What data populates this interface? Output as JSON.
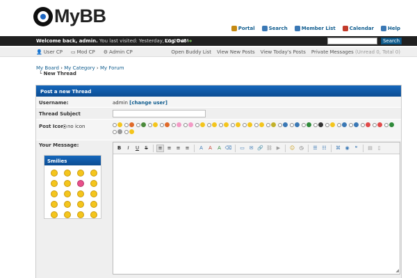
{
  "logo": {
    "text": "MyBB"
  },
  "toplinks": [
    {
      "label": "Portal",
      "icon": "portal-icon",
      "color": "#c58a12"
    },
    {
      "label": "Search",
      "icon": "search-icon",
      "color": "#3a78b5"
    },
    {
      "label": "Member List",
      "icon": "members-icon",
      "color": "#3a78b5"
    },
    {
      "label": "Calendar",
      "icon": "calendar-icon",
      "color": "#c23b2b"
    },
    {
      "label": "Help",
      "icon": "help-icon",
      "color": "#3a78b5"
    }
  ],
  "welcome": {
    "greeting": "Welcome back, admin.",
    "last_visit": "You last visited: Yesterday, 01:27 AM",
    "logout": "Log Out",
    "search_button": "Search",
    "search_placeholder": ""
  },
  "panel": {
    "left": [
      "User CP",
      "Mod CP",
      "Admin CP"
    ],
    "right": [
      "Open Buddy List",
      "View New Posts",
      "View Today's Posts"
    ],
    "pm_label": "Private Messages",
    "pm_counts": "(Unread 0, Total 0)"
  },
  "breadcrumb": {
    "items": [
      "My Board",
      "My Category",
      "My Forum"
    ],
    "sep": "›",
    "current": "New Thread",
    "current_prefix": "└"
  },
  "form": {
    "title": "Post a new Thread",
    "username_label": "Username:",
    "username_value": "admin",
    "change_user": "[change user]",
    "subject_label": "Thread Subject",
    "subject_value": "",
    "icon_label": "Post Icon:",
    "no_icon": "no icon",
    "message_label": "Your Message:",
    "smilies_title": "Smilies"
  },
  "post_icons": [
    "#f4c51c",
    "#e06a2a",
    "#4a8a3a",
    "#f4c51c",
    "#e06a2a",
    "#f39bc6",
    "#f39bc6",
    "#f4c51c",
    "#f4c51c",
    "#f4c51c",
    "#f4c51c",
    "#f4c51c",
    "#f4c51c",
    "#c2b12a",
    "#3a78b5",
    "#3a78b5",
    "#2f8a3a",
    "#333333",
    "#f4c51c",
    "#3a78b5",
    "#3a78b5",
    "#e04a4a",
    "#e04a4a",
    "#2f8a3a",
    "#999999",
    "#f4c51c"
  ],
  "smilies_count": 20,
  "toolbar_buttons": [
    {
      "name": "bold-button",
      "label": "B",
      "style": "bold"
    },
    {
      "name": "italic-button",
      "label": "I",
      "style": "italic"
    },
    {
      "name": "underline-button",
      "label": "U",
      "style": "underline"
    },
    {
      "name": "strike-button",
      "label": "S",
      "style": "strike"
    },
    "sep",
    {
      "name": "align-left-button",
      "label": "≡",
      "sel": true
    },
    {
      "name": "align-center-button",
      "label": "≡"
    },
    {
      "name": "align-right-button",
      "label": "≡"
    },
    {
      "name": "justify-button",
      "label": "≡"
    },
    "sep",
    {
      "name": "font-button",
      "label": "A",
      "color": "#3a78b5"
    },
    {
      "name": "size-button",
      "label": "A",
      "color": "#c23b2b"
    },
    {
      "name": "color-button",
      "label": "A",
      "color": "#2f8a3a"
    },
    {
      "name": "remove-format-button",
      "label": "⌫",
      "color": "#3a78b5"
    },
    "sep",
    {
      "name": "image-button",
      "label": "▭",
      "color": "#3a78b5"
    },
    {
      "name": "email-button",
      "label": "✉",
      "color": "#3a78b5"
    },
    {
      "name": "link-button",
      "label": "🔗",
      "color": "#3a78b5"
    },
    {
      "name": "unlink-button",
      "label": "⛓",
      "color": "#999"
    },
    {
      "name": "video-button",
      "label": "▶",
      "color": "#999"
    },
    "sep",
    {
      "name": "smiley-button",
      "label": "☺",
      "color": "#c99a10"
    },
    {
      "name": "date-button",
      "label": "◷",
      "color": "#555"
    },
    "sep",
    {
      "name": "bullet-list-button",
      "label": "☰",
      "color": "#3a78b5"
    },
    {
      "name": "ordered-list-button",
      "label": "☷",
      "color": "#3a78b5"
    },
    "sep",
    {
      "name": "code-button",
      "label": "⌘",
      "color": "#3a78b5"
    },
    {
      "name": "php-button",
      "label": "◉",
      "color": "#3a78b5"
    },
    {
      "name": "quote-button",
      "label": "❝",
      "color": "#3a78b5"
    },
    "sep",
    {
      "name": "source-button",
      "label": "▤",
      "color": "#999"
    },
    {
      "name": "maximize-button",
      "label": "▯",
      "color": "#999"
    }
  ]
}
